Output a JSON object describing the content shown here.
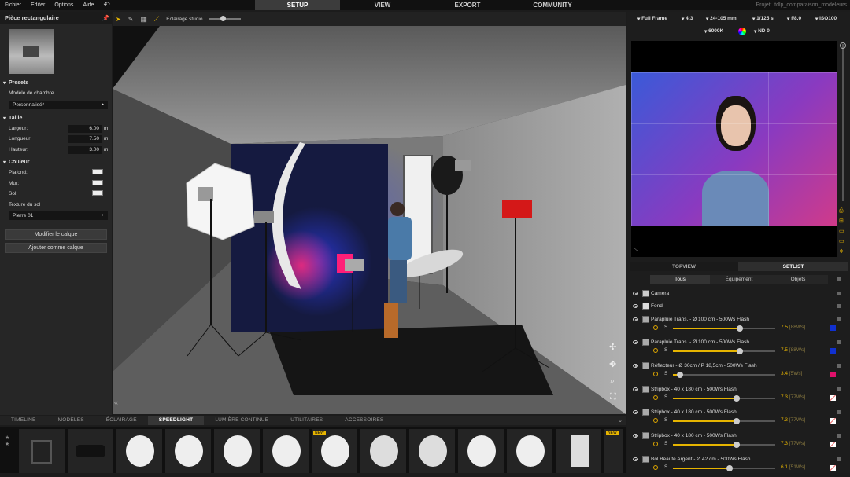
{
  "menubar": {
    "items": [
      "Fichier",
      "Editer",
      "Options",
      "Aide"
    ],
    "modes": [
      "SETUP",
      "VIEW",
      "EXPORT",
      "COMMUNITY"
    ],
    "project": "Projet: ltdlp_comparaison_modeleurs"
  },
  "toolbar": {
    "lighting_preset": "Éclairage studio"
  },
  "left_panel": {
    "title": "Pièce rectangulaire",
    "presets_label": "Presets",
    "room_model_label": "Modèle de chambre",
    "room_model_value": "Personnalisé*",
    "size_label": "Taille",
    "width_label": "Largeur:",
    "width": "6.00",
    "length_label": "Longueur:",
    "length": "7.50",
    "height_label": "Hauteur:",
    "height": "3.00",
    "unit": "m",
    "color_label": "Couleur",
    "ceiling_label": "Plafond:",
    "wall_label": "Mur:",
    "floor_label": "Sol:",
    "floor_texture_label": "Texture du sol",
    "floor_texture_value": "Pierre 01",
    "btn_modify_layer": "Modifier le calque",
    "btn_add_layer": "Ajouter comme calque"
  },
  "camera": {
    "format": "Full Frame",
    "ratio": "4:3",
    "lens": "24-105 mm",
    "shutter": "1/125 s",
    "aperture": "f/8.0",
    "iso": "ISO100",
    "wb": "6000K",
    "nd": "ND 0"
  },
  "bottom_tabs": [
    "TIMELINE",
    "MODÈLES",
    "ÉCLAIRAGE",
    "SPEEDLIGHT",
    "LUMIÈRE CONTINUE",
    "UTILITAIRES",
    "ACCESSOIRES"
  ],
  "bottom_active": "SPEEDLIGHT",
  "right_tabs": [
    "TOPVIEW",
    "SETLIST"
  ],
  "filter_tabs": [
    "Tous",
    "Équipement",
    "Objets"
  ],
  "setlist": [
    {
      "name": "Camera",
      "slider": false
    },
    {
      "name": "Fond",
      "slider": false
    },
    {
      "name": "Parapluie Trans. - Ø 100 cm - 500Ws Flash",
      "slider": true,
      "power": "7.5",
      "ws": "[88Ws]",
      "level": 0.65,
      "color": "#1030d0"
    },
    {
      "name": "Parapluie Trans. - Ø 100 cm - 500Ws Flash",
      "slider": true,
      "power": "7.5",
      "ws": "[88Ws]",
      "level": 0.65,
      "color": "#1030d0"
    },
    {
      "name": "Réflecteur - Ø 30cm / P 18,5cm - 500Ws Flash",
      "slider": true,
      "power": "3.4",
      "ws": "[5Ws]",
      "level": 0.07,
      "color": "#e0106a"
    },
    {
      "name": "Stripbox - 40 x 180 cm - 500Ws Flash",
      "slider": true,
      "power": "7.3",
      "ws": "[77Ws]",
      "level": 0.62,
      "color": "none"
    },
    {
      "name": "Stripbox - 40 x 180 cm - 500Ws Flash",
      "slider": true,
      "power": "7.3",
      "ws": "[77Ws]",
      "level": 0.62,
      "color": "none"
    },
    {
      "name": "Stripbox - 40 x 180 cm - 500Ws Flash",
      "slider": true,
      "power": "7.3",
      "ws": "[77Ws]",
      "level": 0.62,
      "color": "none"
    },
    {
      "name": "Bol Beauté Argent - Ø 42 cm - 500Ws Flash",
      "slider": true,
      "power": "6.1",
      "ws": "[51Ws]",
      "level": 0.55,
      "color": "none"
    }
  ],
  "slider_s": "S",
  "new_badge": "NEW",
  "colors": {
    "accent": "#e6b400",
    "bg": "#1c1c1c"
  }
}
